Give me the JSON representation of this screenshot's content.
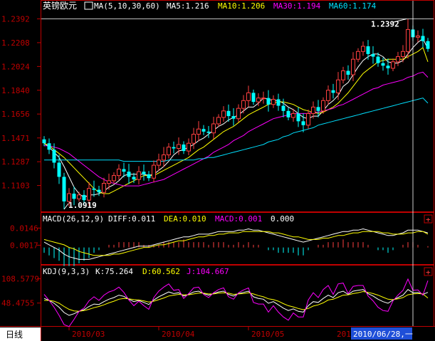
{
  "colors": {
    "background": "#000000",
    "frame": "#c00000",
    "axis_text": "#c00000",
    "up": "#ff4040",
    "down": "#00ffff",
    "ma5": "#ffffff",
    "ma10": "#ffff00",
    "ma30": "#ff00ff",
    "ma60": "#00e0ff",
    "crosshair": "#ffffff",
    "date_highlight_bg": "#1f4fd8",
    "period_tab_bg": "#ffffff",
    "period_tab_text": "#000000"
  },
  "header": {
    "instrument": "英镑欧元",
    "ma_label": "MA(5,10,30,60)",
    "ma5": "MA5:1.216",
    "ma10": "MA10:1.206",
    "ma30": "MA30:1.194",
    "ma60": "MA60:1.174"
  },
  "macd_header": {
    "label": "MACD(26,12,9)",
    "diff": "DIFF:0.011",
    "dea": "DEA:0.010",
    "macd": "MACD:0.001",
    "extra": "0.000"
  },
  "kdj_header": {
    "label": "KDJ(9,3,3)",
    "k": "K:75.264",
    "d": "D:60.562",
    "j": "J:104.667"
  },
  "footer": {
    "period_tab": "日线",
    "cursor_date": "2010/06/28,一",
    "partial_label": "201"
  },
  "panel_buttons": [
    "+",
    "+"
  ],
  "chart_data": [
    {
      "type": "candlestick",
      "title": "英镑欧元",
      "y_ticks": [
        "1.2392",
        "1.2208",
        "1.2024",
        "1.1840",
        "1.1656",
        "1.1471",
        "1.1287",
        "1.1103"
      ],
      "y_tick_values": [
        1.2392,
        1.2208,
        1.2024,
        1.184,
        1.1656,
        1.1471,
        1.1287,
        1.1103
      ],
      "ylim": [
        1.0919,
        1.245
      ],
      "x_ticks": [
        "2010/03",
        "2010/04",
        "2010/05"
      ],
      "x_tick_positions_bar_index": [
        5,
        23,
        41
      ],
      "annotations": [
        {
          "label": "1.2392",
          "value": 1.2392,
          "bar_index": 73
        },
        {
          "label": "1.0919",
          "value": 1.0919,
          "bar_index": 4
        }
      ],
      "close": [
        1.143,
        1.138,
        1.128,
        1.117,
        1.098,
        1.104,
        1.1,
        1.103,
        1.099,
        1.108,
        1.107,
        1.105,
        1.112,
        1.114,
        1.118,
        1.123,
        1.121,
        1.117,
        1.115,
        1.121,
        1.119,
        1.116,
        1.126,
        1.13,
        1.134,
        1.14,
        1.139,
        1.142,
        1.137,
        1.143,
        1.15,
        1.154,
        1.152,
        1.151,
        1.158,
        1.163,
        1.168,
        1.164,
        1.162,
        1.17,
        1.176,
        1.182,
        1.175,
        1.178,
        1.178,
        1.173,
        1.177,
        1.172,
        1.168,
        1.163,
        1.166,
        1.16,
        1.157,
        1.166,
        1.171,
        1.168,
        1.176,
        1.184,
        1.182,
        1.192,
        1.199,
        1.196,
        1.208,
        1.214,
        1.218,
        1.212,
        1.21,
        1.205,
        1.203,
        1.201,
        1.206,
        1.21,
        1.214,
        1.231,
        1.225,
        1.226,
        1.222,
        1.216
      ],
      "series": [
        {
          "name": "MA5",
          "values": [
            1.143,
            1.14,
            1.136,
            1.132,
            1.125,
            1.117,
            1.109,
            1.104,
            1.101,
            1.103,
            1.103,
            1.104,
            1.106,
            1.109,
            1.111,
            1.114,
            1.118,
            1.119,
            1.119,
            1.119,
            1.119,
            1.118,
            1.119,
            1.122,
            1.125,
            1.129,
            1.134,
            1.137,
            1.138,
            1.14,
            1.142,
            1.145,
            1.147,
            1.15,
            1.153,
            1.156,
            1.158,
            1.161,
            1.163,
            1.165,
            1.168,
            1.171,
            1.171,
            1.174,
            1.178,
            1.177,
            1.176,
            1.176,
            1.174,
            1.171,
            1.169,
            1.166,
            1.163,
            1.162,
            1.164,
            1.164,
            1.168,
            1.173,
            1.176,
            1.18,
            1.187,
            1.19,
            1.196,
            1.202,
            1.207,
            1.21,
            1.212,
            1.212,
            1.21,
            1.206,
            1.205,
            1.205,
            1.207,
            1.212,
            1.217,
            1.221,
            1.224,
            1.216
          ]
        },
        {
          "name": "MA10",
          "values": [
            1.143,
            1.141,
            1.138,
            1.135,
            1.132,
            1.128,
            1.124,
            1.12,
            1.116,
            1.112,
            1.108,
            1.105,
            1.104,
            1.104,
            1.106,
            1.108,
            1.11,
            1.112,
            1.114,
            1.116,
            1.118,
            1.118,
            1.118,
            1.12,
            1.122,
            1.124,
            1.126,
            1.128,
            1.13,
            1.132,
            1.135,
            1.138,
            1.14,
            1.143,
            1.146,
            1.149,
            1.152,
            1.154,
            1.156,
            1.159,
            1.162,
            1.165,
            1.167,
            1.169,
            1.171,
            1.173,
            1.174,
            1.175,
            1.175,
            1.174,
            1.173,
            1.171,
            1.169,
            1.168,
            1.167,
            1.166,
            1.167,
            1.169,
            1.171,
            1.174,
            1.178,
            1.182,
            1.187,
            1.192,
            1.197,
            1.2,
            1.203,
            1.206,
            1.207,
            1.208,
            1.208,
            1.208,
            1.208,
            1.21,
            1.212,
            1.214,
            1.217,
            1.206
          ]
        },
        {
          "name": "MA30",
          "values": [
            1.141,
            1.141,
            1.14,
            1.139,
            1.137,
            1.135,
            1.132,
            1.129,
            1.126,
            1.123,
            1.12,
            1.117,
            1.115,
            1.113,
            1.112,
            1.111,
            1.11,
            1.11,
            1.11,
            1.11,
            1.111,
            1.112,
            1.113,
            1.114,
            1.115,
            1.117,
            1.119,
            1.121,
            1.123,
            1.125,
            1.127,
            1.129,
            1.131,
            1.133,
            1.136,
            1.138,
            1.14,
            1.142,
            1.145,
            1.147,
            1.149,
            1.152,
            1.154,
            1.156,
            1.158,
            1.16,
            1.162,
            1.163,
            1.164,
            1.165,
            1.166,
            1.166,
            1.166,
            1.166,
            1.167,
            1.167,
            1.168,
            1.169,
            1.17,
            1.172,
            1.173,
            1.175,
            1.177,
            1.179,
            1.181,
            1.183,
            1.185,
            1.186,
            1.188,
            1.189,
            1.19,
            1.191,
            1.192,
            1.194,
            1.195,
            1.197,
            1.198,
            1.194
          ]
        },
        {
          "name": "MA60",
          "values": [
            1.13,
            1.13,
            1.13,
            1.13,
            1.13,
            1.13,
            1.13,
            1.13,
            1.13,
            1.13,
            1.13,
            1.13,
            1.13,
            1.13,
            1.13,
            1.13,
            1.129,
            1.129,
            1.129,
            1.129,
            1.129,
            1.129,
            1.129,
            1.129,
            1.129,
            1.13,
            1.13,
            1.13,
            1.13,
            1.13,
            1.13,
            1.131,
            1.131,
            1.132,
            1.132,
            1.133,
            1.134,
            1.135,
            1.136,
            1.137,
            1.138,
            1.139,
            1.14,
            1.141,
            1.142,
            1.144,
            1.145,
            1.146,
            1.148,
            1.149,
            1.151,
            1.152,
            1.153,
            1.154,
            1.155,
            1.157,
            1.158,
            1.159,
            1.16,
            1.161,
            1.162,
            1.163,
            1.164,
            1.165,
            1.166,
            1.167,
            1.168,
            1.169,
            1.17,
            1.171,
            1.172,
            1.173,
            1.174,
            1.175,
            1.176,
            1.177,
            1.178,
            1.174
          ]
        }
      ]
    },
    {
      "type": "line",
      "title": "MACD(26,12,9)",
      "y_ticks": [
        "0.0146",
        "0.0017"
      ],
      "y_tick_values": [
        0.0146,
        0.0017
      ],
      "ylim": [
        -0.012,
        0.018
      ],
      "series": [
        {
          "name": "DIFF",
          "values": [
            0.004,
            0.002,
            0.0,
            -0.002,
            -0.005,
            -0.007,
            -0.008,
            -0.009,
            -0.009,
            -0.009,
            -0.008,
            -0.007,
            -0.006,
            -0.005,
            -0.004,
            -0.003,
            -0.002,
            -0.001,
            0.0,
            0.001,
            0.001,
            0.001,
            0.002,
            0.003,
            0.004,
            0.005,
            0.006,
            0.007,
            0.008,
            0.008,
            0.009,
            0.01,
            0.01,
            0.01,
            0.011,
            0.012,
            0.012,
            0.012,
            0.012,
            0.013,
            0.013,
            0.014,
            0.013,
            0.013,
            0.012,
            0.011,
            0.01,
            0.009,
            0.008,
            0.007,
            0.006,
            0.005,
            0.004,
            0.005,
            0.006,
            0.007,
            0.008,
            0.009,
            0.01,
            0.011,
            0.012,
            0.012,
            0.013,
            0.013,
            0.014,
            0.013,
            0.012,
            0.011,
            0.01,
            0.009,
            0.009,
            0.01,
            0.011,
            0.013,
            0.013,
            0.013,
            0.012,
            0.011
          ]
        },
        {
          "name": "DEA",
          "values": [
            0.006,
            0.005,
            0.004,
            0.003,
            0.002,
            0.0,
            -0.001,
            -0.003,
            -0.004,
            -0.005,
            -0.006,
            -0.006,
            -0.006,
            -0.006,
            -0.005,
            -0.005,
            -0.004,
            -0.003,
            -0.002,
            -0.001,
            0.0,
            0.0,
            0.001,
            0.002,
            0.002,
            0.003,
            0.004,
            0.005,
            0.005,
            0.006,
            0.007,
            0.008,
            0.008,
            0.009,
            0.009,
            0.01,
            0.01,
            0.011,
            0.011,
            0.011,
            0.012,
            0.012,
            0.012,
            0.012,
            0.012,
            0.012,
            0.011,
            0.011,
            0.01,
            0.009,
            0.008,
            0.008,
            0.007,
            0.006,
            0.006,
            0.006,
            0.007,
            0.007,
            0.008,
            0.009,
            0.009,
            0.01,
            0.011,
            0.011,
            0.012,
            0.012,
            0.012,
            0.012,
            0.011,
            0.011,
            0.01,
            0.01,
            0.01,
            0.011,
            0.011,
            0.012,
            0.012,
            0.01
          ]
        },
        {
          "name": "MACD",
          "values": [
            -0.004,
            -0.006,
            -0.008,
            -0.01,
            -0.014,
            -0.014,
            -0.014,
            -0.012,
            -0.01,
            -0.008,
            -0.004,
            -0.002,
            0.0,
            0.002,
            0.002,
            0.004,
            0.004,
            0.004,
            0.004,
            0.004,
            0.002,
            0.002,
            0.002,
            0.002,
            0.004,
            0.004,
            0.004,
            0.004,
            0.006,
            0.004,
            0.004,
            0.004,
            0.004,
            0.002,
            0.004,
            0.004,
            0.004,
            0.002,
            0.002,
            0.004,
            0.002,
            0.004,
            0.002,
            0.002,
            0.0,
            -0.002,
            -0.002,
            -0.004,
            -0.004,
            -0.004,
            -0.004,
            -0.006,
            -0.006,
            -0.002,
            0.0,
            0.002,
            0.002,
            0.004,
            0.004,
            0.004,
            0.006,
            0.004,
            0.004,
            0.004,
            0.004,
            0.002,
            0.0,
            -0.002,
            -0.002,
            -0.004,
            -0.002,
            0.0,
            0.002,
            0.004,
            0.004,
            0.002,
            0.0,
            0.001
          ]
        }
      ]
    },
    {
      "type": "line",
      "title": "KDJ(9,3,3)",
      "y_ticks": [
        "108.5779",
        "48.4755"
      ],
      "y_tick_values": [
        108.5779,
        48.4755
      ],
      "ylim": [
        -5,
        115
      ],
      "series": [
        {
          "name": "K",
          "values": [
            60,
            55,
            48,
            38,
            25,
            18,
            22,
            28,
            32,
            40,
            46,
            45,
            52,
            58,
            62,
            68,
            65,
            58,
            52,
            55,
            50,
            45,
            56,
            64,
            70,
            76,
            72,
            74,
            66,
            70,
            76,
            78,
            72,
            68,
            72,
            76,
            78,
            70,
            66,
            72,
            75,
            78,
            64,
            60,
            58,
            48,
            52,
            44,
            36,
            30,
            34,
            28,
            26,
            42,
            52,
            50,
            60,
            68,
            62,
            74,
            78,
            70,
            78,
            80,
            82,
            72,
            66,
            58,
            52,
            48,
            56,
            62,
            68,
            82,
            74,
            75,
            70,
            75
          ]
        },
        {
          "name": "D",
          "values": [
            55,
            55,
            53,
            48,
            40,
            33,
            29,
            28,
            30,
            33,
            37,
            40,
            44,
            49,
            53,
            58,
            60,
            59,
            57,
            56,
            54,
            51,
            53,
            57,
            61,
            66,
            68,
            70,
            69,
            69,
            71,
            73,
            73,
            71,
            71,
            73,
            74,
            73,
            70,
            71,
            72,
            74,
            71,
            67,
            64,
            59,
            57,
            53,
            47,
            42,
            39,
            35,
            32,
            35,
            41,
            44,
            49,
            56,
            58,
            63,
            68,
            69,
            72,
            74,
            77,
            75,
            72,
            68,
            63,
            58,
            57,
            59,
            62,
            69,
            71,
            72,
            71,
            61
          ]
        },
        {
          "name": "J",
          "values": [
            70,
            55,
            38,
            18,
            -5,
            -10,
            8,
            28,
            36,
            54,
            64,
            55,
            68,
            76,
            80,
            88,
            75,
            56,
            42,
            53,
            42,
            33,
            62,
            78,
            88,
            96,
            80,
            82,
            60,
            72,
            86,
            88,
            70,
            62,
            74,
            82,
            86,
            64,
            58,
            74,
            81,
            86,
            50,
            46,
            46,
            26,
            42,
            26,
            14,
            6,
            24,
            14,
            14,
            56,
            74,
            62,
            82,
            92,
            70,
            96,
            98,
            72,
            90,
            92,
            92,
            66,
            54,
            38,
            30,
            28,
            54,
            68,
            80,
            108,
            80,
            81,
            68,
            104
          ]
        }
      ]
    }
  ]
}
